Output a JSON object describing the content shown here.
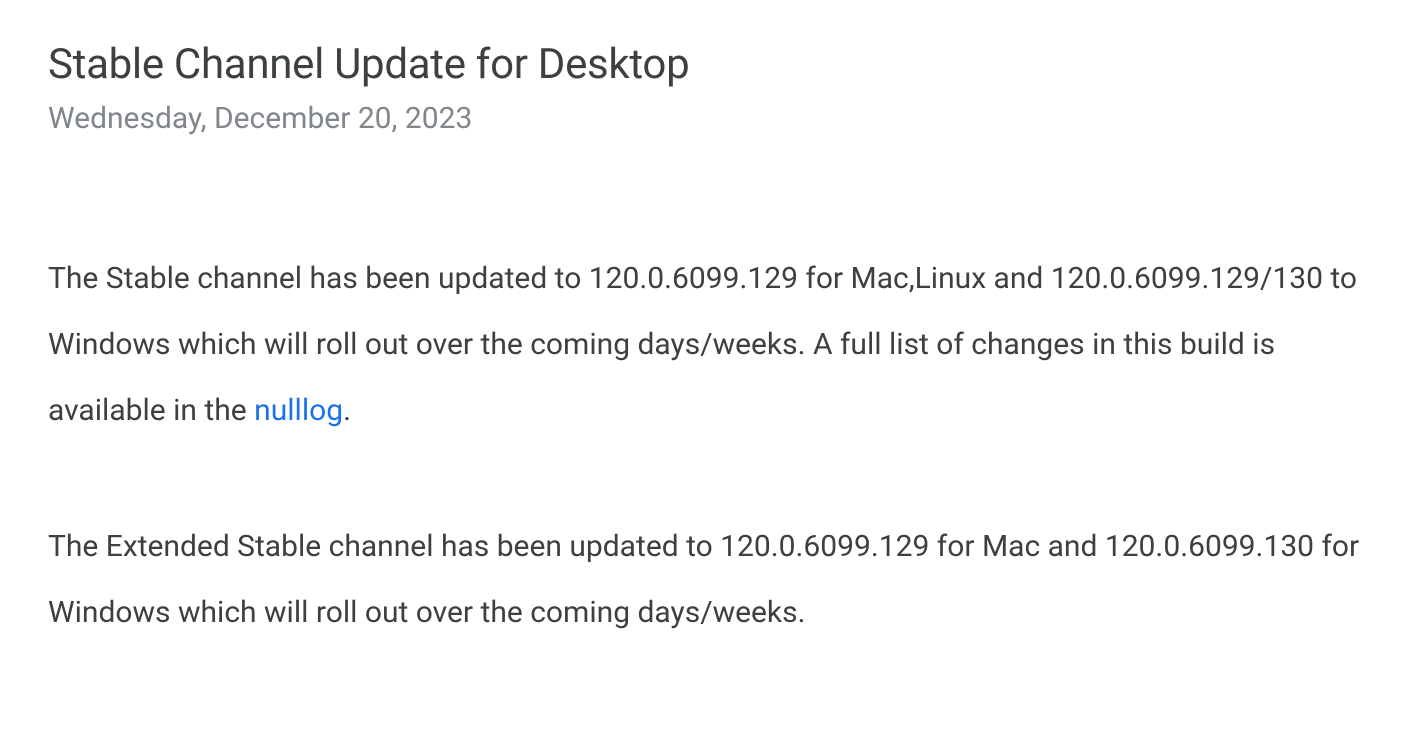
{
  "post": {
    "title": "Stable Channel Update for Desktop",
    "date": "Wednesday, December 20, 2023",
    "paragraph1_before_link": "The Stable channel has been updated to 120.0.6099.129 for Mac,Linux and  120.0.6099.129/130 to Windows which will roll out over the coming days/weeks. A full list of changes in this build is available in the ",
    "link_text": "nulllog",
    "paragraph1_after_link": ".",
    "paragraph2": "The Extended Stable channel has been updated to 120.0.6099.129 for Mac and 120.0.6099.130 for Windows which will roll out over the coming days/weeks."
  }
}
